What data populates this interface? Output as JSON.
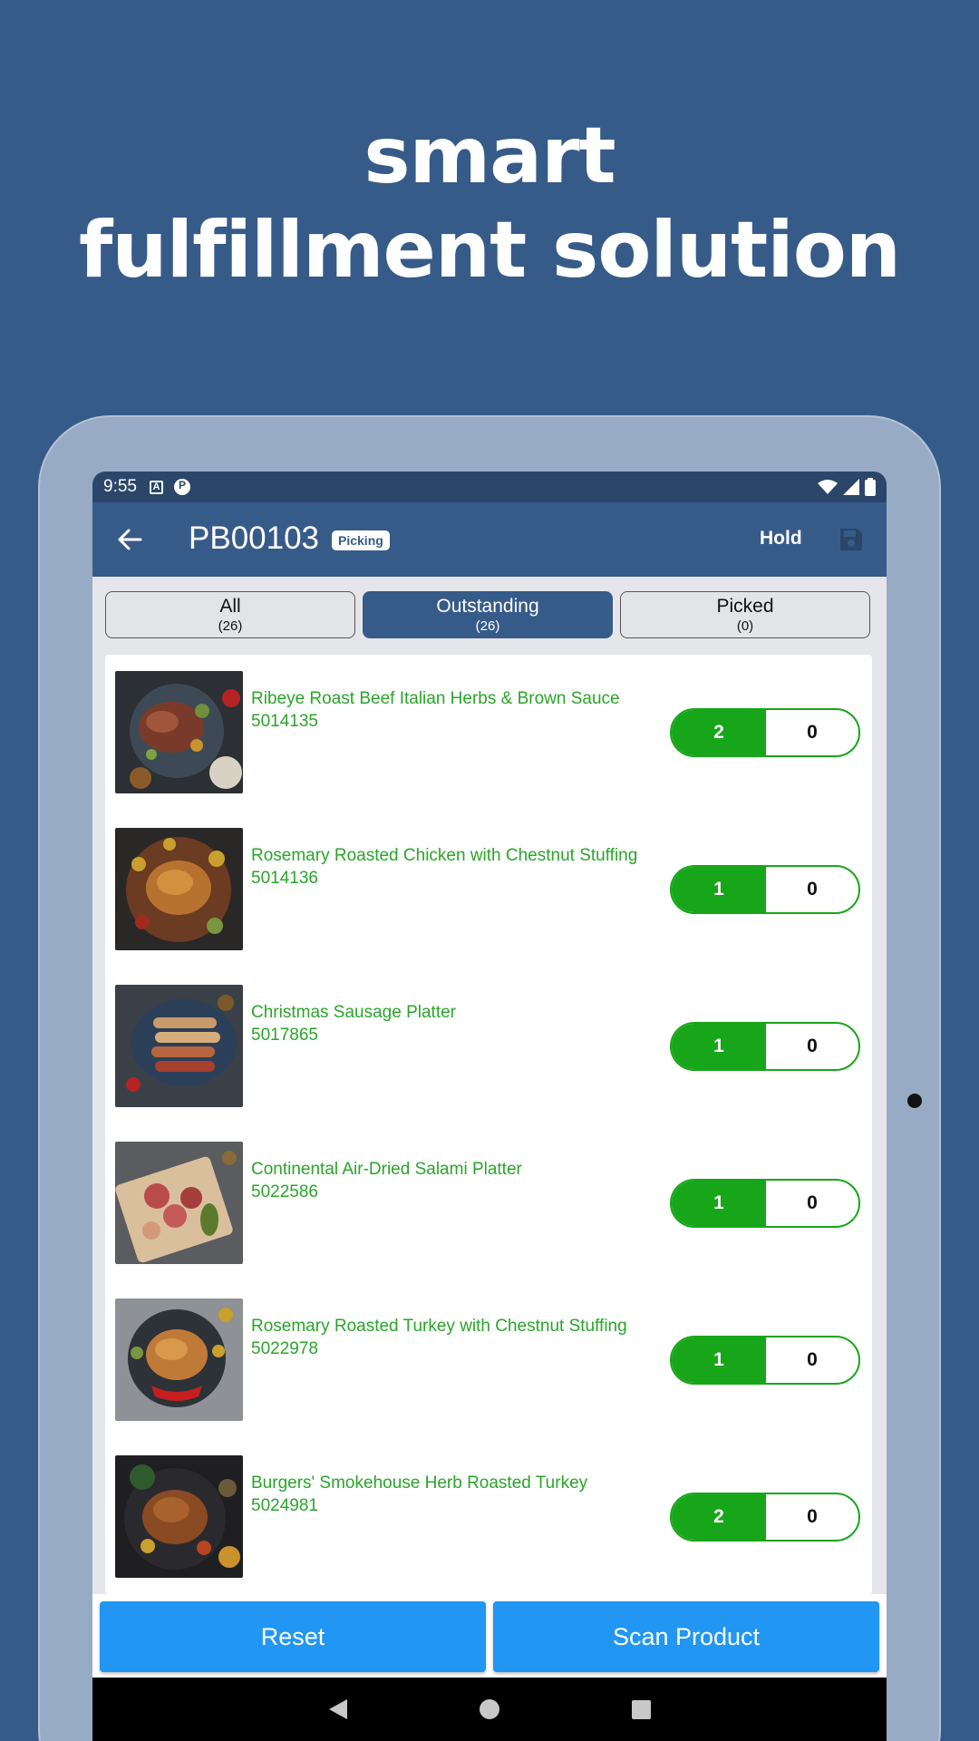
{
  "promo": {
    "line1": "smart",
    "line2": "fulfillment solution"
  },
  "statusbar": {
    "time": "9:55",
    "icons": [
      "a-notification-icon",
      "p-notification-icon",
      "wifi-icon",
      "signal-icon",
      "battery-icon"
    ]
  },
  "appbar": {
    "title": "PB00103",
    "badge": "Picking",
    "hold_label": "Hold",
    "icons": [
      "back-arrow-icon",
      "save-icon"
    ]
  },
  "tabs": [
    {
      "label": "All",
      "count": "(26)",
      "active": false
    },
    {
      "label": "Outstanding",
      "count": "(26)",
      "active": true
    },
    {
      "label": "Picked",
      "count": "(0)",
      "active": false
    }
  ],
  "items": [
    {
      "name": "Ribeye Roast Beef Italian Herbs & Brown Sauce",
      "sku": "5014135",
      "required": "2",
      "picked": "0"
    },
    {
      "name": "Rosemary Roasted Chicken with Chestnut Stuffing",
      "sku": "5014136",
      "required": "1",
      "picked": "0"
    },
    {
      "name": "Christmas Sausage Platter",
      "sku": "5017865",
      "required": "1",
      "picked": "0"
    },
    {
      "name": "Continental Air-Dried Salami Platter",
      "sku": "5022586",
      "required": "1",
      "picked": "0"
    },
    {
      "name": "Rosemary Roasted Turkey with Chestnut Stuffing",
      "sku": "5022978",
      "required": "1",
      "picked": "0"
    },
    {
      "name": "Burgers' Smokehouse Herb Roasted Turkey",
      "sku": "5024981",
      "required": "2",
      "picked": "0"
    }
  ],
  "actions": {
    "reset_label": "Reset",
    "scan_label": "Scan Product"
  },
  "colors": {
    "background": "#375b89",
    "accent_green": "#17a61a",
    "item_text_green": "#2aa52a",
    "button_blue": "#2196f3"
  }
}
